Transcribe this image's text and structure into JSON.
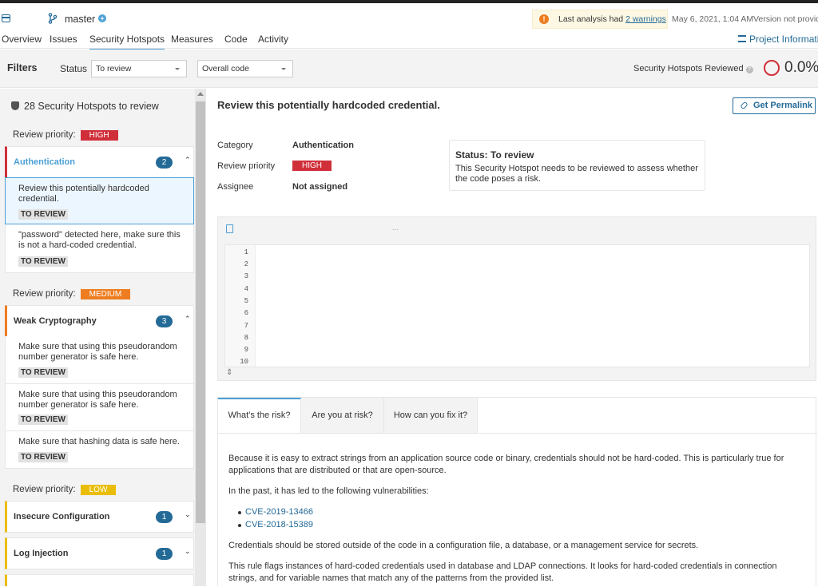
{
  "header": {
    "branch": "master",
    "warning_prefix": "Last analysis had ",
    "warning_link": "2 warnings",
    "date": "May 6, 2021, 1:04 AM",
    "version": "Version not provided",
    "nav": [
      "Overview",
      "Issues",
      "Security Hotspots",
      "Measures",
      "Code",
      "Activity"
    ],
    "project_info": "Project Information"
  },
  "filters": {
    "title": "Filters",
    "status_label": "Status",
    "status_value": "To review",
    "scope_value": "Overall code",
    "reviewed_label": "Security Hotspots Reviewed",
    "reviewed_pct": "0.0%"
  },
  "sidebar": {
    "heading": "28 Security Hotspots to review",
    "priority_label": "Review priority:",
    "groups": [
      {
        "priority": "HIGH",
        "color": "#d02f3a",
        "categories": [
          {
            "name": "Authentication",
            "count": "2",
            "expanded": true,
            "items": [
              {
                "text": "Review this potentially hardcoded credential.",
                "status": "TO REVIEW"
              },
              {
                "text": "\"password\" detected here, make sure this is not a hard-coded credential.",
                "status": "TO REVIEW"
              }
            ]
          }
        ]
      },
      {
        "priority": "MEDIUM",
        "color": "#ed7d20",
        "categories": [
          {
            "name": "Weak Cryptography",
            "count": "3",
            "expanded": true,
            "items": [
              {
                "text": "Make sure that using this pseudorandom number generator is safe here.",
                "status": "TO REVIEW"
              },
              {
                "text": "Make sure that using this pseudorandom number generator is safe here.",
                "status": "TO REVIEW"
              },
              {
                "text": "Make sure that hashing data is safe here.",
                "status": "TO REVIEW"
              }
            ]
          }
        ]
      },
      {
        "priority": "LOW",
        "color": "#eabe06",
        "categories": [
          {
            "name": "Insecure Configuration",
            "count": "1",
            "expanded": false
          },
          {
            "name": "Log Injection",
            "count": "1",
            "expanded": false
          }
        ]
      }
    ]
  },
  "main": {
    "title": "Review this potentially hardcoded credential.",
    "permalink": "Get Permalink",
    "category_label": "Category",
    "category_value": "Authentication",
    "priority_label": "Review priority",
    "priority_value": "HIGH",
    "assignee_label": "Assignee",
    "assignee_value": "Not assigned",
    "status_title": "Status: To review",
    "status_desc": "This Security Hotspot needs to be reviewed to assess whether the code poses a risk.",
    "code_dots": "...",
    "line_numbers": [
      "1",
      "2",
      "3",
      "4",
      "5",
      "6",
      "7",
      "8",
      "9",
      "10"
    ],
    "tabs": [
      "What's the risk?",
      "Are you at risk?",
      "How can you fix it?"
    ],
    "risk_p1": "Because it is easy to extract strings from an application source code or binary, credentials should not be hard-coded. This is particularly true for applications that are distributed or that are open-source.",
    "risk_p2": "In the past, it has led to the following vulnerabilities:",
    "cves": [
      "CVE-2019-13466",
      "CVE-2018-15389"
    ],
    "risk_p3": "Credentials should be stored outside of the code in a configuration file, a database, or a management service for secrets.",
    "risk_p4": "This rule flags instances of hard-coded credentials used in database and LDAP connections. It looks for hard-coded credentials in connection strings, and for variable names that match any of the patterns from the provided list."
  }
}
